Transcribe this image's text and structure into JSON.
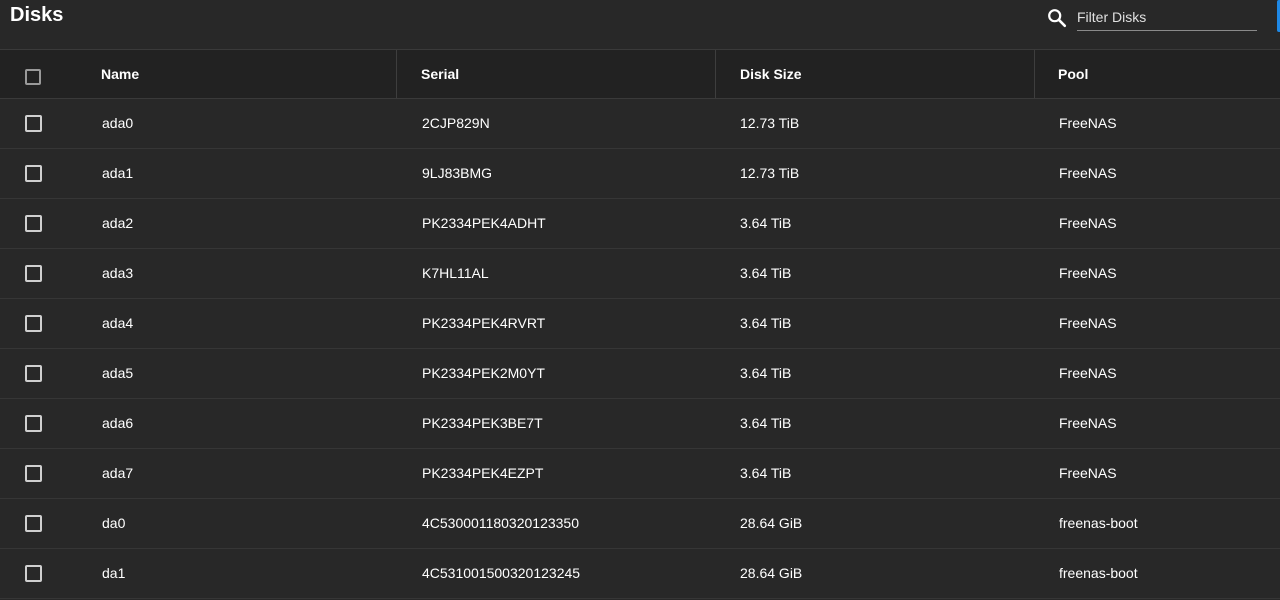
{
  "header": {
    "title": "Disks",
    "filter_placeholder": "Filter Disks",
    "search_icon": "search-icon"
  },
  "table": {
    "columns": [
      "Name",
      "Serial",
      "Disk Size",
      "Pool"
    ],
    "rows": [
      {
        "name": "ada0",
        "serial": "2CJP829N",
        "size": "12.73 TiB",
        "pool": "FreeNAS"
      },
      {
        "name": "ada1",
        "serial": "9LJ83BMG",
        "size": "12.73 TiB",
        "pool": "FreeNAS"
      },
      {
        "name": "ada2",
        "serial": "PK2334PEK4ADHT",
        "size": "3.64 TiB",
        "pool": "FreeNAS"
      },
      {
        "name": "ada3",
        "serial": "K7HL11AL",
        "size": "3.64 TiB",
        "pool": "FreeNAS"
      },
      {
        "name": "ada4",
        "serial": "PK2334PEK4RVRT",
        "size": "3.64 TiB",
        "pool": "FreeNAS"
      },
      {
        "name": "ada5",
        "serial": "PK2334PEK2M0YT",
        "size": "3.64 TiB",
        "pool": "FreeNAS"
      },
      {
        "name": "ada6",
        "serial": "PK2334PEK3BE7T",
        "size": "3.64 TiB",
        "pool": "FreeNAS"
      },
      {
        "name": "ada7",
        "serial": "PK2334PEK4EZPT",
        "size": "3.64 TiB",
        "pool": "FreeNAS"
      },
      {
        "name": "da0",
        "serial": "4C530001180320123350",
        "size": "28.64 GiB",
        "pool": "freenas-boot"
      },
      {
        "name": "da1",
        "serial": "4C531001500320123245",
        "size": "28.64 GiB",
        "pool": "freenas-boot"
      }
    ]
  },
  "colors": {
    "background": "#282828",
    "header_background": "#222222",
    "accent": "#1e88e5"
  }
}
